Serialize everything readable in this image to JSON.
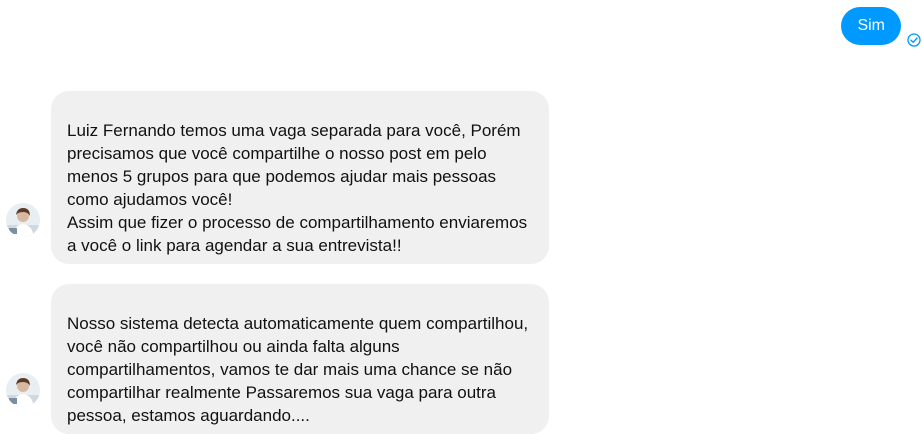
{
  "outgoing": {
    "text": "Sim"
  },
  "messages": [
    {
      "text": "Luiz Fernando temos uma vaga separada para você, Porém precisamos que você compartilhe o nosso post em pelo menos 5 grupos para que podemos ajudar mais pessoas como ajudamos você!\nAssim que fizer o processo de compartilhamento enviaremos a você o link para agendar a sua entrevista!!"
    },
    {
      "text": "Nosso sistema detecta automaticamente quem compartilhou, você não compartilhou ou ainda falta alguns compartilhamentos, vamos te dar mais uma chance se não compartilhar realmente Passaremos sua vaga para outra pessoa, estamos aguardando...."
    }
  ],
  "colors": {
    "outgoing_bubble": "#0099ff",
    "incoming_bubble": "#f0f0f0"
  },
  "icons": {
    "seen_indicator": "check-circle-icon",
    "sender_avatar": "avatar"
  }
}
